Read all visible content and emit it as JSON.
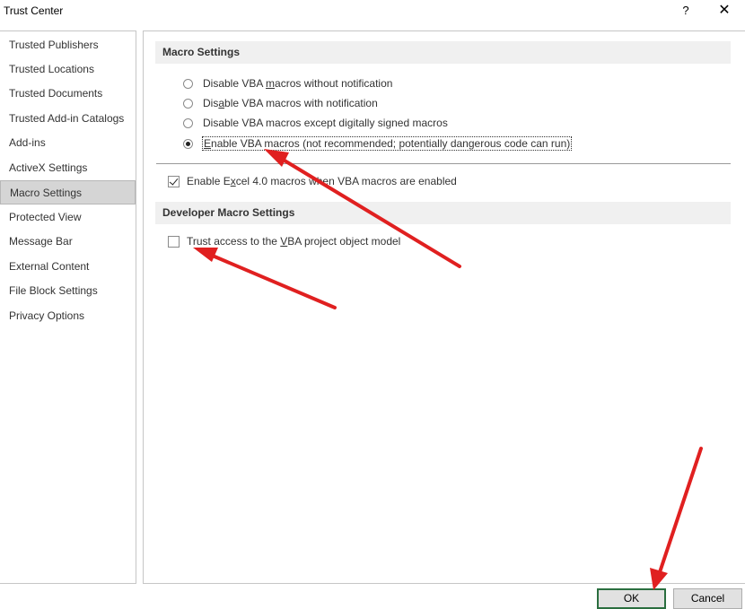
{
  "window": {
    "title": "Trust Center",
    "help_label": "?",
    "close_label": "✕"
  },
  "sidebar": {
    "items": [
      {
        "label": "Trusted Publishers"
      },
      {
        "label": "Trusted Locations"
      },
      {
        "label": "Trusted Documents"
      },
      {
        "label": "Trusted Add-in Catalogs"
      },
      {
        "label": "Add-ins"
      },
      {
        "label": "ActiveX Settings"
      },
      {
        "label": "Macro Settings",
        "selected": true
      },
      {
        "label": "Protected View"
      },
      {
        "label": "Message Bar"
      },
      {
        "label": "External Content"
      },
      {
        "label": "File Block Settings"
      },
      {
        "label": "Privacy Options"
      }
    ]
  },
  "macro_settings": {
    "header": "Macro Settings",
    "options": [
      {
        "pre": "Disable VBA ",
        "key": "m",
        "post": "acros without notification",
        "checked": false
      },
      {
        "pre": "Dis",
        "key": "a",
        "post": "ble VBA macros with notification",
        "checked": false
      },
      {
        "pre": "Disable VBA macros except di",
        "key": "g",
        "post": "itally signed macros",
        "checked": false
      },
      {
        "pre": "",
        "key": "E",
        "post": "nable VBA macros (not recommended; potentially dangerous code can run)",
        "checked": true
      }
    ],
    "excel4": {
      "pre": "Enable E",
      "key": "x",
      "post": "cel 4.0 macros when VBA macros are enabled",
      "checked": true
    }
  },
  "developer_settings": {
    "header": "Developer Macro Settings",
    "trust_vba": {
      "pre": "Trust access to the ",
      "key": "V",
      "post": "BA project object model",
      "checked": false
    }
  },
  "buttons": {
    "ok": "OK",
    "cancel": "Cancel"
  },
  "annotation_color": "#e02020"
}
